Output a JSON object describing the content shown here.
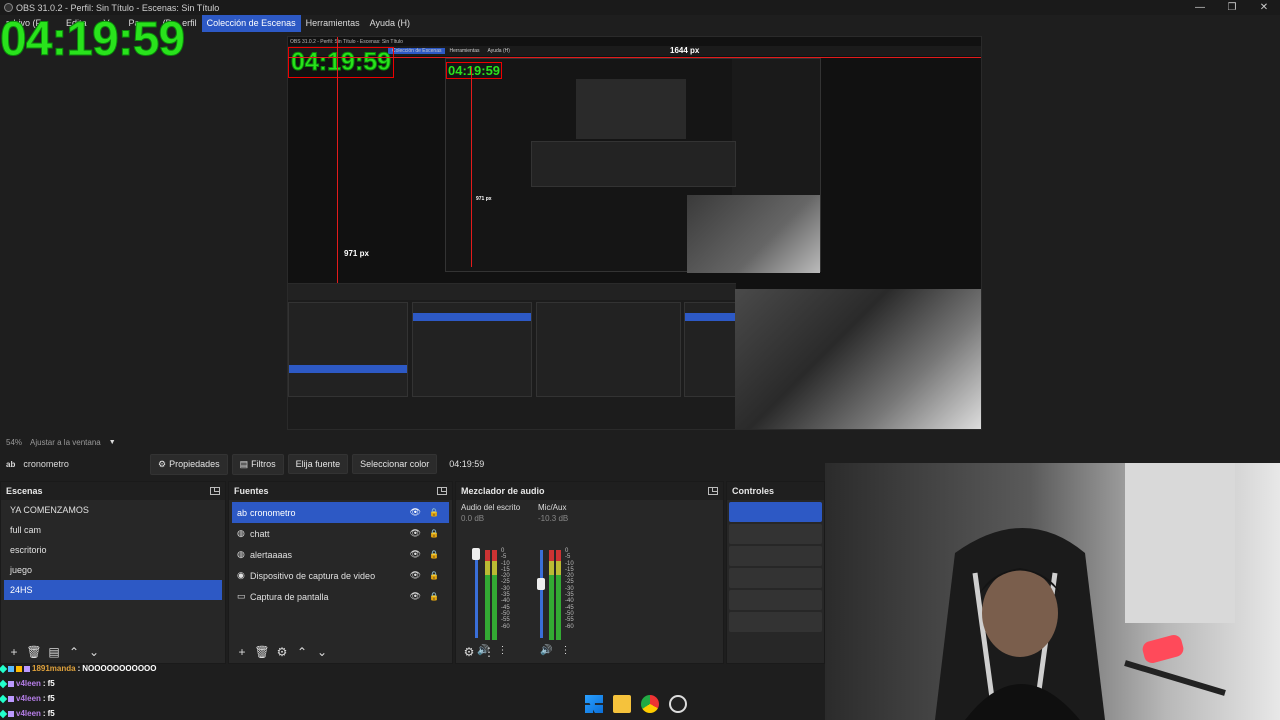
{
  "window": {
    "title": "OBS 31.0.2 - Perfil: Sin Título - Escenas: Sin Título",
    "controls": [
      "—",
      "❐",
      "✕"
    ]
  },
  "menu": {
    "items": [
      "Archivo (F)",
      "Editar",
      "Ver",
      "Panel de...",
      "Perfil",
      "Colección de Escenas",
      "Herramientas",
      "Ayuda (H)"
    ],
    "visible_items": [
      "rchivo (F",
      "Edita",
      "V",
      "Pa",
      "(D",
      "erfil"
    ],
    "active": "Colección de Escenas",
    "tools": "Herramientas",
    "help": "Ayuda (H)"
  },
  "timer_overlay": "04:19:59",
  "preview": {
    "nested_title": "OBS 31.0.2 - Perfil: Sin Título - Escenas: Sin Título",
    "width_label": "1644 px",
    "height_label": "971 px",
    "inner_height_label": "971 px",
    "nested_menu": [
      "Colección de Escenas",
      "Herramientas",
      "Ayuda (H)"
    ],
    "nested_timer": "04:19:59"
  },
  "status": {
    "zoom": "54%",
    "fit": "Ajustar a la ventana"
  },
  "toolbar": {
    "source_icon": "ab",
    "source_name": "cronometro",
    "properties": "Propiedades",
    "filters": "Filtros",
    "choose_source": "Elija fuente",
    "select_color": "Seleccionar color",
    "timer_text": "04:19:59"
  },
  "scenes": {
    "title": "Escenas",
    "items": [
      "YA COMENZAMOS",
      "full cam",
      "escritorio",
      "juego",
      "24HS"
    ],
    "selected": "24HS"
  },
  "sources": {
    "title": "Fuentes",
    "items": [
      {
        "icon": "ab",
        "label": "cronometro"
      },
      {
        "icon": "◍",
        "label": "chatt"
      },
      {
        "icon": "◍",
        "label": "alertaaaas"
      },
      {
        "icon": "◉",
        "label": "Dispositivo de captura de video"
      },
      {
        "icon": "▭",
        "label": "Captura de pantalla"
      }
    ],
    "selected": "cronometro"
  },
  "mixer": {
    "title": "Mezclador de audio",
    "channels": [
      {
        "name": "Audio del escrito",
        "db": "0.0 dB",
        "level": 0.94
      },
      {
        "name": "Mic/Aux",
        "db": "-10.3 dB",
        "level": 0.6
      }
    ],
    "scale": [
      "0",
      "-5",
      "-10",
      "-15",
      "-20",
      "-25",
      "-30",
      "-35",
      "-40",
      "-45",
      "-50",
      "-55",
      "-60"
    ]
  },
  "controls": {
    "title": "Controles"
  },
  "chat": [
    {
      "user": "1891manda",
      "msg": "NOOOOOOOOOOO",
      "color": "#e0a23c"
    },
    {
      "user": "v4leen",
      "msg": "f5",
      "color": "#b57de8"
    },
    {
      "user": "v4leen",
      "msg": "f5",
      "color": "#b57de8"
    },
    {
      "user": "v4leen",
      "msg": "f5",
      "color": "#b57de8"
    }
  ],
  "accent_color": "#2d59c5",
  "timer_color": "#29e31c"
}
